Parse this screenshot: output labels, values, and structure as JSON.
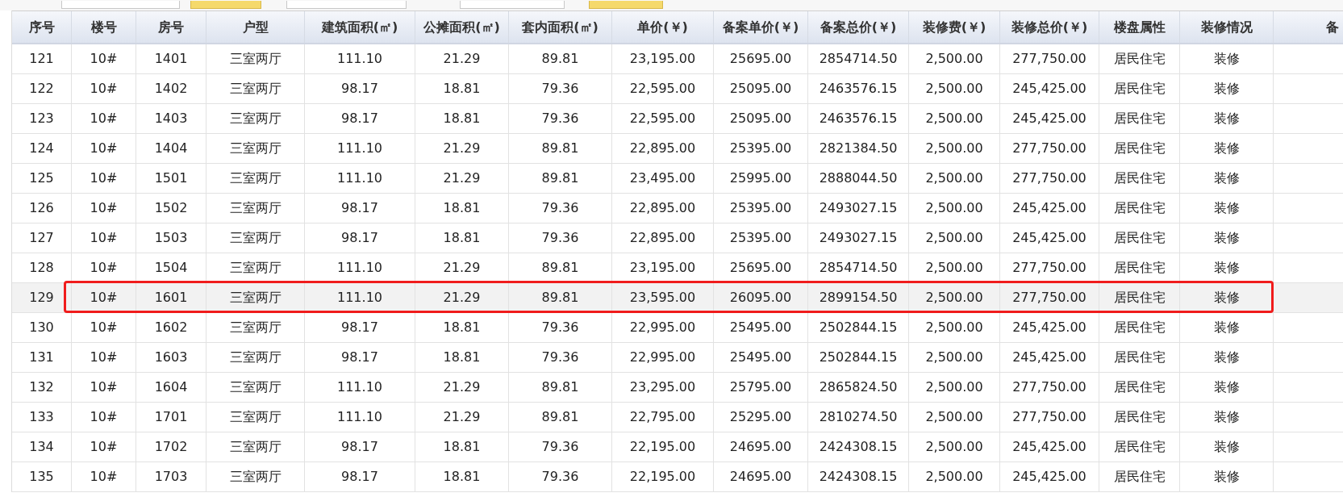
{
  "table": {
    "columns": [
      "序号",
      "楼号",
      "房号",
      "户型",
      "建筑面积(㎡)",
      "公摊面积(㎡)",
      "套内面积(㎡)",
      "单价(￥)",
      "备案单价(￥)",
      "备案总价(￥)",
      "装修费(￥)",
      "装修总价(￥)",
      "楼盘属性",
      "装修情况",
      "备"
    ],
    "rows": [
      {
        "selected": false,
        "cells": [
          "121",
          "10#",
          "1401",
          "三室两厅",
          "111.10",
          "21.29",
          "89.81",
          "23,195.00",
          "25695.00",
          "2854714.50",
          "2,500.00",
          "277,750.00",
          "居民住宅",
          "装修"
        ]
      },
      {
        "selected": false,
        "cells": [
          "122",
          "10#",
          "1402",
          "三室两厅",
          "98.17",
          "18.81",
          "79.36",
          "22,595.00",
          "25095.00",
          "2463576.15",
          "2,500.00",
          "245,425.00",
          "居民住宅",
          "装修"
        ]
      },
      {
        "selected": false,
        "cells": [
          "123",
          "10#",
          "1403",
          "三室两厅",
          "98.17",
          "18.81",
          "79.36",
          "22,595.00",
          "25095.00",
          "2463576.15",
          "2,500.00",
          "245,425.00",
          "居民住宅",
          "装修"
        ]
      },
      {
        "selected": false,
        "cells": [
          "124",
          "10#",
          "1404",
          "三室两厅",
          "111.10",
          "21.29",
          "89.81",
          "22,895.00",
          "25395.00",
          "2821384.50",
          "2,500.00",
          "277,750.00",
          "居民住宅",
          "装修"
        ]
      },
      {
        "selected": false,
        "cells": [
          "125",
          "10#",
          "1501",
          "三室两厅",
          "111.10",
          "21.29",
          "89.81",
          "23,495.00",
          "25995.00",
          "2888044.50",
          "2,500.00",
          "277,750.00",
          "居民住宅",
          "装修"
        ]
      },
      {
        "selected": false,
        "cells": [
          "126",
          "10#",
          "1502",
          "三室两厅",
          "98.17",
          "18.81",
          "79.36",
          "22,895.00",
          "25395.00",
          "2493027.15",
          "2,500.00",
          "245,425.00",
          "居民住宅",
          "装修"
        ]
      },
      {
        "selected": false,
        "cells": [
          "127",
          "10#",
          "1503",
          "三室两厅",
          "98.17",
          "18.81",
          "79.36",
          "22,895.00",
          "25395.00",
          "2493027.15",
          "2,500.00",
          "245,425.00",
          "居民住宅",
          "装修"
        ]
      },
      {
        "selected": false,
        "cells": [
          "128",
          "10#",
          "1504",
          "三室两厅",
          "111.10",
          "21.29",
          "89.81",
          "23,195.00",
          "25695.00",
          "2854714.50",
          "2,500.00",
          "277,750.00",
          "居民住宅",
          "装修"
        ]
      },
      {
        "selected": true,
        "cells": [
          "129",
          "10#",
          "1601",
          "三室两厅",
          "111.10",
          "21.29",
          "89.81",
          "23,595.00",
          "26095.00",
          "2899154.50",
          "2,500.00",
          "277,750.00",
          "居民住宅",
          "装修"
        ]
      },
      {
        "selected": false,
        "cells": [
          "130",
          "10#",
          "1602",
          "三室两厅",
          "98.17",
          "18.81",
          "79.36",
          "22,995.00",
          "25495.00",
          "2502844.15",
          "2,500.00",
          "245,425.00",
          "居民住宅",
          "装修"
        ]
      },
      {
        "selected": false,
        "cells": [
          "131",
          "10#",
          "1603",
          "三室两厅",
          "98.17",
          "18.81",
          "79.36",
          "22,995.00",
          "25495.00",
          "2502844.15",
          "2,500.00",
          "245,425.00",
          "居民住宅",
          "装修"
        ]
      },
      {
        "selected": false,
        "cells": [
          "132",
          "10#",
          "1604",
          "三室两厅",
          "111.10",
          "21.29",
          "89.81",
          "23,295.00",
          "25795.00",
          "2865824.50",
          "2,500.00",
          "277,750.00",
          "居民住宅",
          "装修"
        ]
      },
      {
        "selected": false,
        "cells": [
          "133",
          "10#",
          "1701",
          "三室两厅",
          "111.10",
          "21.29",
          "89.81",
          "22,795.00",
          "25295.00",
          "2810274.50",
          "2,500.00",
          "277,750.00",
          "居民住宅",
          "装修"
        ]
      },
      {
        "selected": false,
        "cells": [
          "134",
          "10#",
          "1702",
          "三室两厅",
          "98.17",
          "18.81",
          "79.36",
          "22,195.00",
          "24695.00",
          "2424308.15",
          "2,500.00",
          "245,425.00",
          "居民住宅",
          "装修"
        ]
      },
      {
        "selected": false,
        "cells": [
          "135",
          "10#",
          "1703",
          "三室两厅",
          "98.17",
          "18.81",
          "79.36",
          "22,195.00",
          "24695.00",
          "2424308.15",
          "2,500.00",
          "245,425.00",
          "居民住宅",
          "装修"
        ]
      }
    ]
  }
}
